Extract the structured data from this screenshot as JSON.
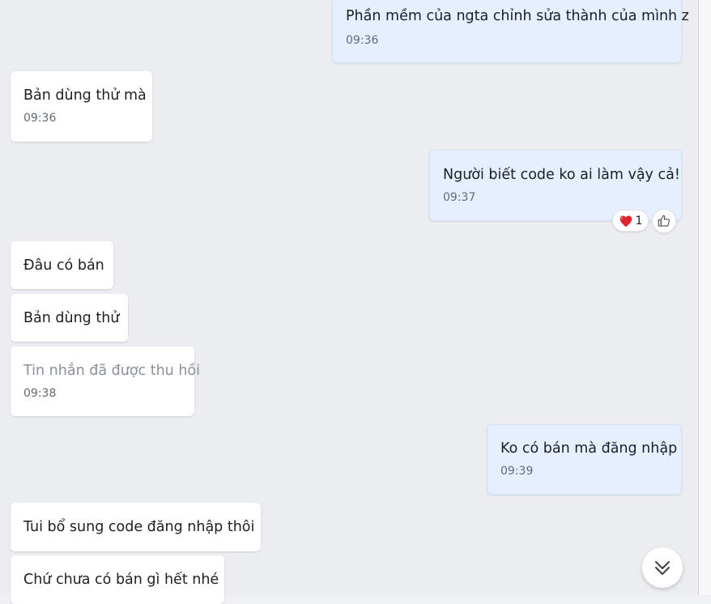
{
  "messages": [
    {
      "text": "Phần mềm của ngta chỉnh sửa thành của mình z",
      "time": "09:36",
      "from": "me"
    },
    {
      "text": "Bản dùng thử mà",
      "time": "09:36",
      "from": "other"
    },
    {
      "text": "Người biết code ko ai làm vậy cả!",
      "time": "09:37",
      "from": "me",
      "reaction": {
        "icon": "heart-icon",
        "count": "1"
      }
    },
    {
      "text": "Đâu có bán",
      "from": "other"
    },
    {
      "text": "Bản dùng thử",
      "from": "other"
    },
    {
      "text": "Tin nhắn đã được thu hồi",
      "time": "09:38",
      "from": "other",
      "recalled": true
    },
    {
      "text": "Ko có bán mà đăng nhập",
      "time": "09:39",
      "from": "me"
    },
    {
      "text": "Tui bổ sung code đăng nhập thôi",
      "from": "other"
    },
    {
      "text": "Chứ chưa có bán gì hết nhé",
      "from": "other"
    }
  ],
  "colors": {
    "incoming_bubble": "#ffffff",
    "outgoing_bubble": "#e5efff",
    "chat_background": "#ebedf1",
    "reaction_heart": "#e0242f"
  },
  "controls": {
    "like_icon": "thumbs-up-icon",
    "scroll_down_icon": "double-chevron-down-icon"
  }
}
